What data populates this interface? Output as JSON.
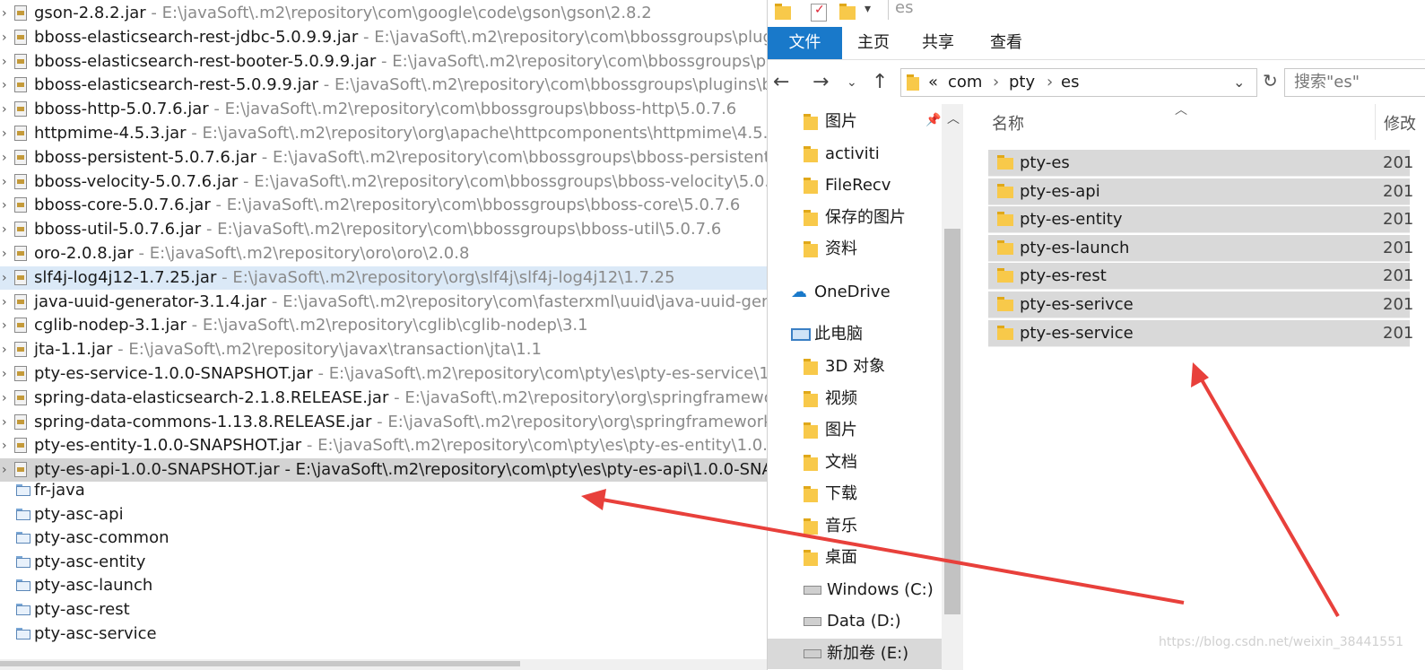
{
  "tree": {
    "jars": [
      {
        "name": "gson-2.8.2.jar",
        "path": "E:\\javaSoft\\.m2\\repository\\com\\google\\code\\gson\\gson\\2.8.2"
      },
      {
        "name": "bboss-elasticsearch-rest-jdbc-5.0.9.9.jar",
        "path": "E:\\javaSoft\\.m2\\repository\\com\\bbossgroups\\plugins"
      },
      {
        "name": "bboss-elasticsearch-rest-booter-5.0.9.9.jar",
        "path": "E:\\javaSoft\\.m2\\repository\\com\\bbossgroups\\plug"
      },
      {
        "name": "bboss-elasticsearch-rest-5.0.9.9.jar",
        "path": "E:\\javaSoft\\.m2\\repository\\com\\bbossgroups\\plugins\\bbo"
      },
      {
        "name": "bboss-http-5.0.7.6.jar",
        "path": "E:\\javaSoft\\.m2\\repository\\com\\bbossgroups\\bboss-http\\5.0.7.6"
      },
      {
        "name": "httpmime-4.5.3.jar",
        "path": "E:\\javaSoft\\.m2\\repository\\org\\apache\\httpcomponents\\httpmime\\4.5.3"
      },
      {
        "name": "bboss-persistent-5.0.7.6.jar",
        "path": "E:\\javaSoft\\.m2\\repository\\com\\bbossgroups\\bboss-persistent\\5.0"
      },
      {
        "name": "bboss-velocity-5.0.7.6.jar",
        "path": "E:\\javaSoft\\.m2\\repository\\com\\bbossgroups\\bboss-velocity\\5.0.7.6"
      },
      {
        "name": "bboss-core-5.0.7.6.jar",
        "path": "E:\\javaSoft\\.m2\\repository\\com\\bbossgroups\\bboss-core\\5.0.7.6"
      },
      {
        "name": "bboss-util-5.0.7.6.jar",
        "path": "E:\\javaSoft\\.m2\\repository\\com\\bbossgroups\\bboss-util\\5.0.7.6"
      },
      {
        "name": "oro-2.0.8.jar",
        "path": "E:\\javaSoft\\.m2\\repository\\oro\\oro\\2.0.8"
      },
      {
        "name": "slf4j-log4j12-1.7.25.jar",
        "path": "E:\\javaSoft\\.m2\\repository\\org\\slf4j\\slf4j-log4j12\\1.7.25"
      },
      {
        "name": "java-uuid-generator-3.1.4.jar",
        "path": "E:\\javaSoft\\.m2\\repository\\com\\fasterxml\\uuid\\java-uuid-genera"
      },
      {
        "name": "cglib-nodep-3.1.jar",
        "path": "E:\\javaSoft\\.m2\\repository\\cglib\\cglib-nodep\\3.1"
      },
      {
        "name": "jta-1.1.jar",
        "path": "E:\\javaSoft\\.m2\\repository\\javax\\transaction\\jta\\1.1"
      },
      {
        "name": "pty-es-service-1.0.0-SNAPSHOT.jar",
        "path": "E:\\javaSoft\\.m2\\repository\\com\\pty\\es\\pty-es-service\\1.0.0"
      },
      {
        "name": "spring-data-elasticsearch-2.1.8.RELEASE.jar",
        "path": "E:\\javaSoft\\.m2\\repository\\org\\springframework\\d"
      },
      {
        "name": "spring-data-commons-1.13.8.RELEASE.jar",
        "path": "E:\\javaSoft\\.m2\\repository\\org\\springframework\\da"
      },
      {
        "name": "pty-es-entity-1.0.0-SNAPSHOT.jar",
        "path": "E:\\javaSoft\\.m2\\repository\\com\\pty\\es\\pty-es-entity\\1.0.0-"
      },
      {
        "name": "pty-es-api-1.0.0-SNAPSHOT.jar",
        "path": "E:\\javaSoft\\.m2\\repository\\com\\pty\\es\\pty-es-api\\1.0.0-SNAP"
      }
    ],
    "separator": " - ",
    "projects": [
      "fr-java",
      "pty-asc-api",
      "pty-asc-common",
      "pty-asc-entity",
      "pty-asc-launch",
      "pty-asc-rest",
      "pty-asc-service"
    ]
  },
  "explorer": {
    "title": "es",
    "ribbon_tabs": [
      "文件",
      "主页",
      "共享",
      "查看"
    ],
    "breadcrumb": {
      "prefix": "«",
      "parts": [
        "com",
        "pty",
        "es"
      ]
    },
    "search_placeholder": "搜索\"es\"",
    "nav": {
      "quick_access": [
        "图片",
        "activiti",
        "FileRecv",
        "保存的图片",
        "资料"
      ],
      "onedrive": "OneDrive",
      "this_pc": "此电脑",
      "pc_items": [
        "3D 对象",
        "视频",
        "图片",
        "文档",
        "下载",
        "音乐",
        "桌面",
        "Windows (C:)",
        "Data (D:)",
        "新加卷 (E:)"
      ]
    },
    "columns": {
      "name": "名称",
      "modified": "修改"
    },
    "folders": [
      "pty-es",
      "pty-es-api",
      "pty-es-entity",
      "pty-es-launch",
      "pty-es-rest",
      "pty-es-serivce",
      "pty-es-service"
    ],
    "date_prefix": "201"
  },
  "watermark": "https://blog.csdn.net/weixin_38441551",
  "colors": {
    "file_tab": "#1979ca",
    "arrow": "#e8403b",
    "folder": "#f8c94a",
    "selected_row": "#d9d9d9"
  }
}
